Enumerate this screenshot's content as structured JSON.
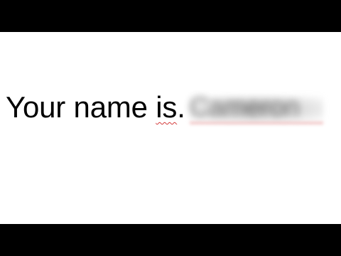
{
  "document": {
    "sentence_start": "Your name ",
    "word_is": "is",
    "period": ".",
    "redacted_name": "Cameron",
    "colors": {
      "text": "#000000",
      "spellcheck_underline": "#d33a3a",
      "background": "#ffffff",
      "letterbox": "#000000"
    }
  }
}
